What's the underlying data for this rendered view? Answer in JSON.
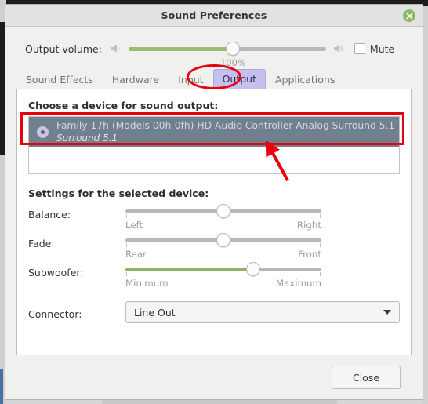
{
  "window": {
    "title": "Sound Preferences",
    "close_icon": "close-icon"
  },
  "volume": {
    "label": "Output volume:",
    "low_icon": "speaker-low-icon",
    "high_icon": "speaker-high-icon",
    "percent_label": "100%",
    "value": 100,
    "fill_percent": 53,
    "mute_label": "Mute",
    "mute_checked": false
  },
  "tabs": [
    {
      "label": "Sound Effects",
      "active": false
    },
    {
      "label": "Hardware",
      "active": false
    },
    {
      "label": "Input",
      "active": false
    },
    {
      "label": "Output",
      "active": true
    },
    {
      "label": "Applications",
      "active": false
    }
  ],
  "output_panel": {
    "device_heading": "Choose a device for sound output:",
    "devices": [
      {
        "title": "Family 17h (Models 00h-0fh) HD Audio Controller Analog Surround 5.1",
        "subtitle": "Surround 5.1",
        "selected": true
      }
    ],
    "settings_heading": "Settings for the selected device:",
    "sliders": [
      {
        "label": "Balance:",
        "left_label": "Left",
        "right_label": "Right",
        "thumb_percent": 50,
        "fill_percent": 0
      },
      {
        "label": "Fade:",
        "left_label": "Rear",
        "right_label": "Front",
        "thumb_percent": 50,
        "fill_percent": 0
      },
      {
        "label": "Subwoofer:",
        "left_label": "Minimum",
        "right_label": "Maximum",
        "thumb_percent": 65,
        "fill_percent": 65
      }
    ],
    "connector": {
      "label": "Connector:",
      "value": "Line Out",
      "caret_icon": "chevron-down-icon"
    }
  },
  "footer": {
    "close_label": "Close"
  },
  "annotations": {
    "accent_color": "#e8000d",
    "tab_highlight": "output-tab-ellipse",
    "device_highlight": "selected-device-rect",
    "pointer": "red-arrow"
  }
}
